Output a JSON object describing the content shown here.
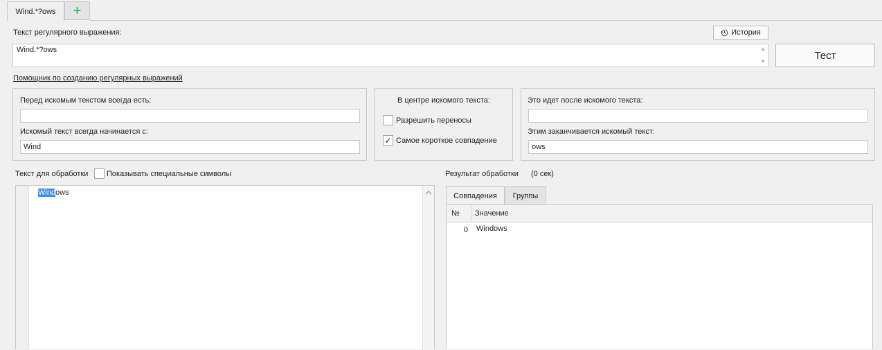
{
  "tabs": {
    "active_label": "Wind.*?ows",
    "add_label": "+"
  },
  "regex": {
    "label": "Текст регулярного выражения:",
    "value": "Wind.*?ows",
    "history_label": "История",
    "test_label": "Тест",
    "helper_link": "Помощник по созданию регулярных выражений"
  },
  "before": {
    "always_label": "Перед искомым текстом всегда есть:",
    "always_value": "",
    "starts_label": "Искомый текст всегда начинается с:",
    "starts_value": "Wind"
  },
  "center": {
    "label": "В центре искомого текста:",
    "allow_wrap_label": "Разрешить переносы",
    "allow_wrap_checked": false,
    "shortest_label": "Самое короткое совпадение",
    "shortest_checked": true,
    "checkmark": "✓"
  },
  "after": {
    "after_label": "Это идет после искомого текста:",
    "after_value": "",
    "ends_label": "Этим заканчивается искомый текст:",
    "ends_value": "ows"
  },
  "source": {
    "label": "Текст для обработки",
    "show_special_label": "Показывать специальные символы",
    "show_special_checked": false,
    "text_selected": "Wind",
    "text_rest": "ows"
  },
  "result": {
    "label": "Результат обработки",
    "time": "(0 сек)",
    "tabs": [
      "Совпадения",
      "Группы"
    ],
    "columns": [
      "№",
      "Значение"
    ],
    "rows": [
      {
        "index": "0",
        "value": "Windows"
      }
    ]
  },
  "colors": {
    "accent_green": "#2ca65a",
    "selection": "#3d8ee6"
  }
}
